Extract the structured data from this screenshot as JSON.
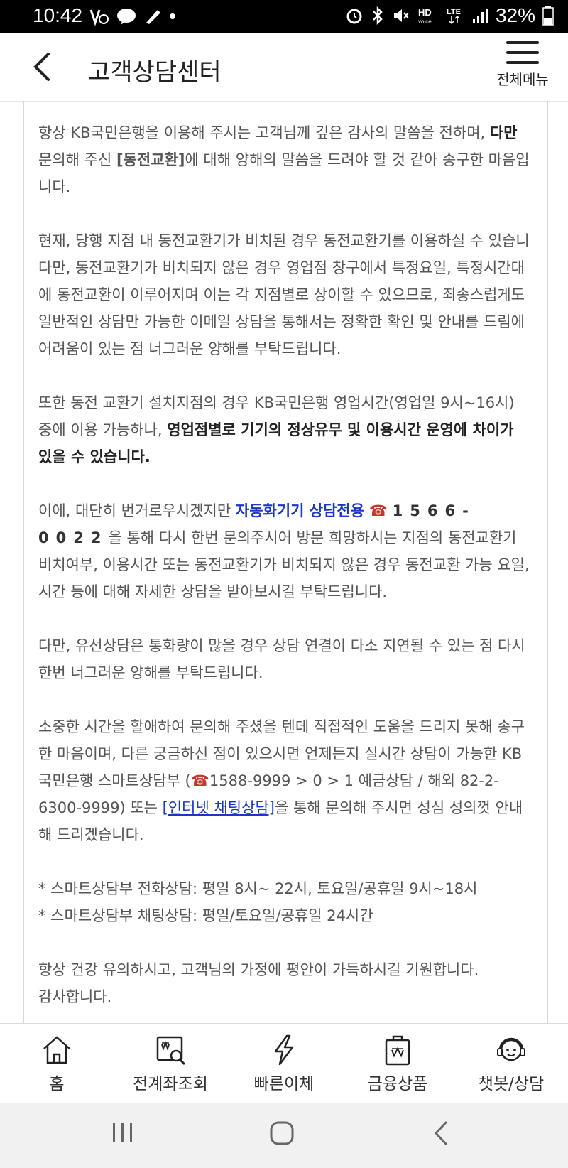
{
  "statusbar": {
    "time": "10:42",
    "battery": "32%",
    "hd_label": "HD",
    "voice_label": "voice",
    "lte_label": "LTE"
  },
  "header": {
    "title": "고객상담센터",
    "menu_label": "전체메뉴"
  },
  "content": {
    "p1": {
      "a": "항상 KB국민은행을 이용해 주시는 고객님께 깊은 감사의 말씀을 전하며, ",
      "b": "다만",
      "c": " 문의해 주신 ",
      "d": "[동전교환]",
      "e": "에 대해 양해의 말씀을 드려야 할 것 같아 송구한 마음입니다."
    },
    "p2": "현재, 당행 지점 내 동전교환기가 비치된 경우 동전교환기를 이용하실 수 있습니다만, 동전교환기가 비치되지 않은 경우 영업점 창구에서 특정요일, 특정시간대에 동전교환이 이루어지며 이는 각 지점별로 상이할 수 있으므로, 죄송스럽게도 일반적인 상담만 가능한 이메일 상담을 통해서는 정확한 확인 및 안내를 드림에 어려움이 있는 점 너그러운 양해를 부탁드립니다.",
    "p3": {
      "a": "또한 동전 교환기 설치지점의 경우 KB국민은행 영업시간(영업일 9시~16시) 중에 이용 가능하나, ",
      "b": "영업점별로 기기의 정상유무 및 이용시간 운영에 차이가 있을 수 있습니다."
    },
    "p4": {
      "a": "이에, 대단히 번거로우시겠지만 ",
      "b": "자동화기기 상담전용",
      "phone_icon": "☎",
      "phone": "1566-0022",
      "c": "을 통해 다시 한번 문의주시어 방문 희망하시는 지점의 동전교환기 비치여부, 이용시간 또는 동전교환기가 비치되지 않은 경우 동전교환 가능 요일, 시간 등에 대해 자세한 상담을 받아보시길 부탁드립니다."
    },
    "p5": "다만, 유선상담은 통화량이 많을 경우 상담 연결이 다소 지연될 수 있는 점 다시 한번 너그러운 양해를 부탁드립니다.",
    "p6": {
      "a": "소중한 시간을 할애하여 문의해 주셨을 텐데 직접적인 도움을 드리지 못해 송구한 마음이며, 다른 궁금하신 점이 있으시면 언제든지 실시간 상담이 가능한 KB국민은행 스마트상담부 (",
      "phone_icon": "☎",
      "b": "1588-9999 > 0 > 1 예금상담 / 해외 82-2-6300-9999) 또는 ",
      "link": "[인터넷 채팅상담]",
      "c": "을 통해 문의해 주시면 성심 성의껏 안내해 드리겠습니다."
    },
    "note1": "* 스마트상담부 전화상담: 평일 8시~ 22시, 토요일/공휴일 9시~18시",
    "note2": "* 스마트상담부 채팅상담: 평일/토요일/공휴일 24시간",
    "closing1": "항상 건강 유의하시고, 고객님의 가정에 평안이 가득하시길 기원합니다.",
    "closing2": "감사합니다."
  },
  "bottom_nav": [
    {
      "label": "홈",
      "icon": "home-icon"
    },
    {
      "label": "전계좌조회",
      "icon": "account-search-icon"
    },
    {
      "label": "빠른이체",
      "icon": "lightning-icon"
    },
    {
      "label": "금융상품",
      "icon": "product-bag-icon"
    },
    {
      "label": "챗봇/상담",
      "icon": "chatbot-icon"
    }
  ]
}
